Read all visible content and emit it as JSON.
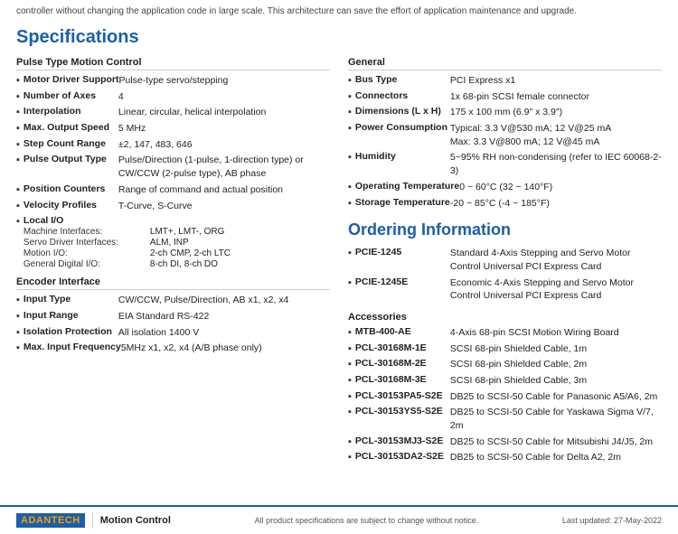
{
  "top_text": "controller without changing the application code in large scale. This architecture can save the effort of application maintenance and upgrade.",
  "page_title": "Specifications",
  "left_column": {
    "pulse_section_title": "Pulse Type Motion Control",
    "pulse_specs": [
      {
        "label": "Motor Driver Support",
        "value": "Pulse-type servo/stepping"
      },
      {
        "label": "Number of Axes",
        "value": "4"
      },
      {
        "label": "Interpolation",
        "value": "Linear, circular, helical interpolation"
      },
      {
        "label": "Max. Output Speed",
        "value": "5 MHz"
      },
      {
        "label": "Step Count Range",
        "value": "±2, 147, 483, 646"
      },
      {
        "label": "Pulse Output Type",
        "value": "Pulse/Direction (1-pulse, 1-direction type) or CW/CCW (2-pulse type), AB phase"
      }
    ],
    "position_specs": [
      {
        "label": "Position Counters",
        "value": "Range of command and actual position"
      },
      {
        "label": "Velocity Profiles",
        "value": "T-Curve, S-Curve"
      }
    ],
    "local_io_label": "Local I/O",
    "local_io_subs": [
      {
        "sublabel": "Machine Interfaces:",
        "subvalue": "LMT+, LMT-, ORG"
      },
      {
        "sublabel": "Servo Driver Interfaces:",
        "subvalue": "ALM, INP"
      },
      {
        "sublabel": "Motion I/O:",
        "subvalue": "2-ch CMP, 2-ch LTC"
      },
      {
        "sublabel": "General Digital I/O:",
        "subvalue": "8-ch DI, 8-ch DO"
      }
    ],
    "encoder_section_title": "Encoder Interface",
    "encoder_specs": [
      {
        "label": "Input Type",
        "value": "CW/CCW, Pulse/Direction, AB x1, x2, x4"
      },
      {
        "label": "Input Range",
        "value": "EIA Standard RS-422"
      },
      {
        "label": "Isolation Protection",
        "value": "All isolation 1400 V"
      },
      {
        "label": "Max. Input Frequency",
        "value": "5MHz x1, x2, x4 (A/B phase only)"
      }
    ]
  },
  "right_column": {
    "general_section_title": "General",
    "general_specs": [
      {
        "label": "Bus Type",
        "value": "PCI Express x1"
      },
      {
        "label": "Connectors",
        "value": "1x 68-pin SCSI female connector"
      },
      {
        "label": "Dimensions (L x H)",
        "value": "175 x 100 mm (6.9\" x 3.9\")"
      },
      {
        "label": "Power Consumption",
        "value": "Typical: 3.3 V@530 mA; 12 V@25 mA\nMax: 3.3 V@800 mA; 12 V@45 mA"
      },
      {
        "label": "Humidity",
        "value": "5~95% RH non-condensing (refer to IEC 60068-2-3)"
      },
      {
        "label": "Operating Temperature",
        "value": "0 ~ 60°C (32 ~ 140°F)"
      },
      {
        "label": "Storage Temperature",
        "value": "-20 ~ 85°C (-4 ~ 185°F)"
      }
    ],
    "ordering_title": "Ordering Information",
    "ordering_items": [
      {
        "label": "PCIE-1245",
        "value": "Standard 4-Axis Stepping and Servo Motor Control Universal PCI Express Card"
      },
      {
        "label": "PCIE-1245E",
        "value": "Economic 4-Axis Stepping and Servo Motor Control Universal PCI Express Card"
      }
    ],
    "accessories_title": "Accessories",
    "accessories_items": [
      {
        "label": "MTB-400-AE",
        "value": "4-Axis 68-pin SCSI Motion Wiring Board"
      },
      {
        "label": "PCL-30168M-1E",
        "value": "SCSI 68-pin Shielded Cable, 1m"
      },
      {
        "label": "PCL-30168M-2E",
        "value": "SCSI 68-pin Shielded Cable, 2m"
      },
      {
        "label": "PCL-30168M-3E",
        "value": "SCSI 68-pin Shielded Cable, 3m"
      },
      {
        "label": "PCL-30153PA5-S2E",
        "value": "DB25 to SCSI-50 Cable for Panasonic A5/A6, 2m"
      },
      {
        "label": "PCL-30153YS5-S2E",
        "value": "DB25 to SCSI-50 Cable for Yaskawa Sigma V/7, 2m"
      },
      {
        "label": "PCL-30153MJ3-S2E",
        "value": "DB25 to SCSI-50 Cable for Mitsubishi J4/J5, 2m"
      },
      {
        "label": "PCL-30153DA2-S2E",
        "value": "DB25 to SCSI-50 Cable for Delta A2, 2m"
      }
    ]
  },
  "footer": {
    "logo_text": "AD",
    "logo_accent": "ANTECH",
    "category": "Motion Control",
    "note": "All product specifications are subject to change without notice.",
    "date": "Last updated: 27-May-2022"
  }
}
